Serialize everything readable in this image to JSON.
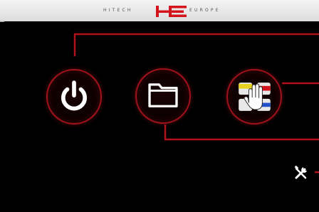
{
  "header": {
    "brand_left": "HITECH",
    "brand_right": "EUROPE",
    "logo_icon": "he-logo",
    "colors": {
      "logo": "#d4141c",
      "text": "#555555",
      "background": "#e8e8e8"
    }
  },
  "main": {
    "buttons": [
      {
        "icon": "power-icon"
      },
      {
        "icon": "folder-icon"
      },
      {
        "icon": "manual-mode-hand-icon"
      }
    ],
    "tools": {
      "icon": "tools-icon"
    },
    "colors": {
      "accent": "#a0121b",
      "icon": "#ffffff",
      "background": "#000000"
    }
  }
}
